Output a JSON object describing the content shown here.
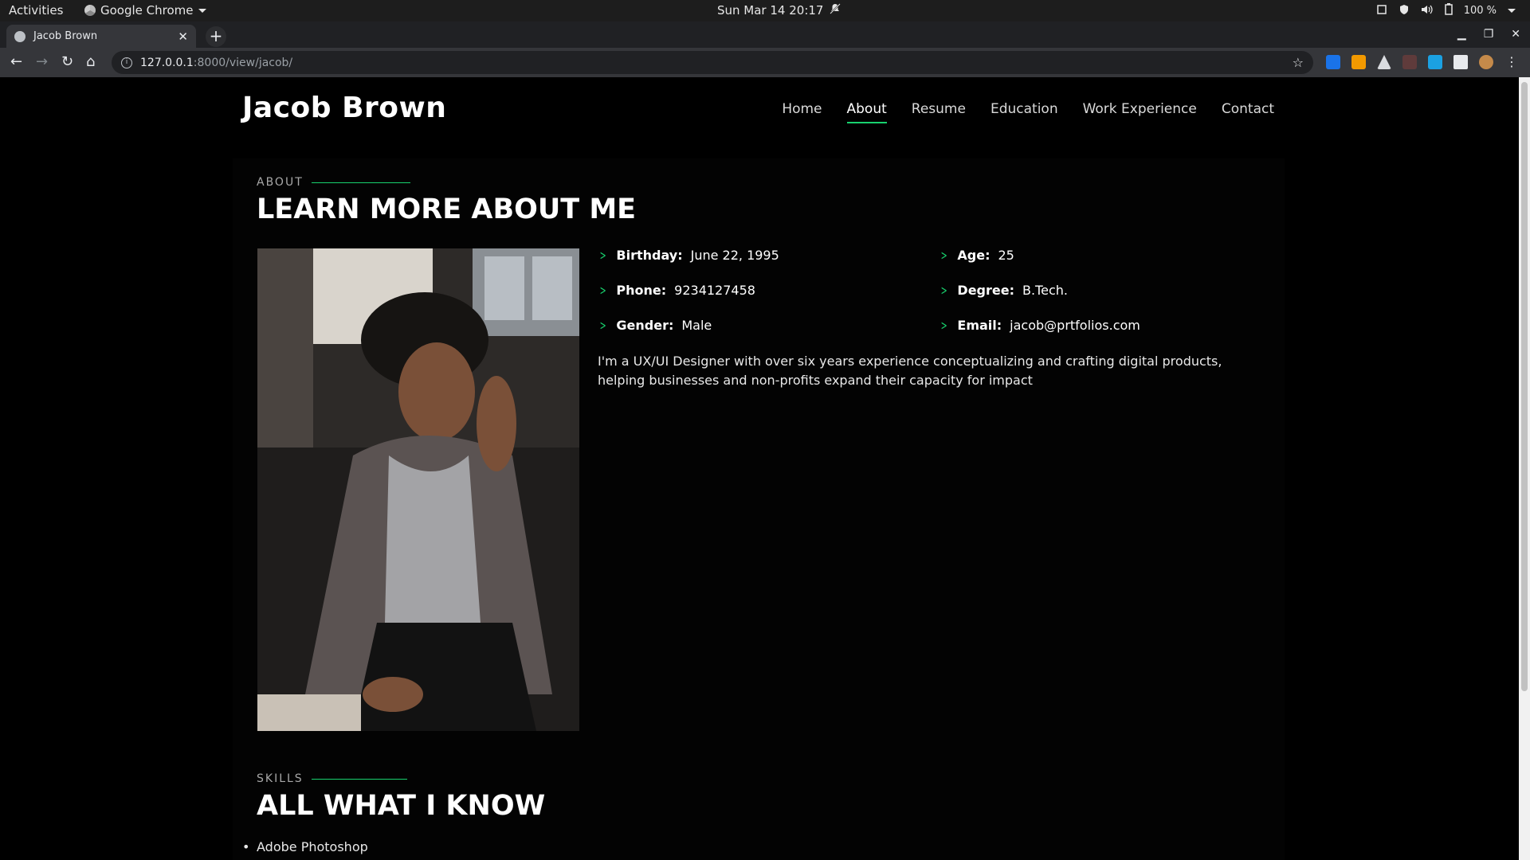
{
  "system": {
    "activities": "Activities",
    "app_name": "Google Chrome",
    "clock": "Sun Mar 14  20:17",
    "battery": "100 %"
  },
  "browser": {
    "tab_title": "Jacob Brown",
    "url_host": "127.0.0.1",
    "url_path": ":8000/view/jacob/"
  },
  "site": {
    "logo": "Jacob Brown",
    "nav": [
      "Home",
      "About",
      "Resume",
      "Education",
      "Work Experience",
      "Contact"
    ],
    "active_nav": "About",
    "accent_color": "#18d26e"
  },
  "about": {
    "eyebrow": "ABOUT",
    "heading": "LEARN MORE ABOUT ME",
    "facts": {
      "birthday": {
        "label": "Birthday:",
        "value": "June 22, 1995"
      },
      "age": {
        "label": "Age:",
        "value": "25"
      },
      "phone": {
        "label": "Phone:",
        "value": "9234127458"
      },
      "degree": {
        "label": "Degree:",
        "value": "B.Tech."
      },
      "gender": {
        "label": "Gender:",
        "value": "Male"
      },
      "email": {
        "label": "Email:",
        "value": "jacob@prtfolios.com"
      }
    },
    "bio": "I'm a UX/UI Designer with over six years experience conceptualizing and crafting digital products, helping businesses and non-profits expand their capacity for impact"
  },
  "skills": {
    "eyebrow": "SKILLS",
    "heading": "ALL WHAT I KNOW",
    "items": [
      "Adobe Photoshop"
    ]
  }
}
